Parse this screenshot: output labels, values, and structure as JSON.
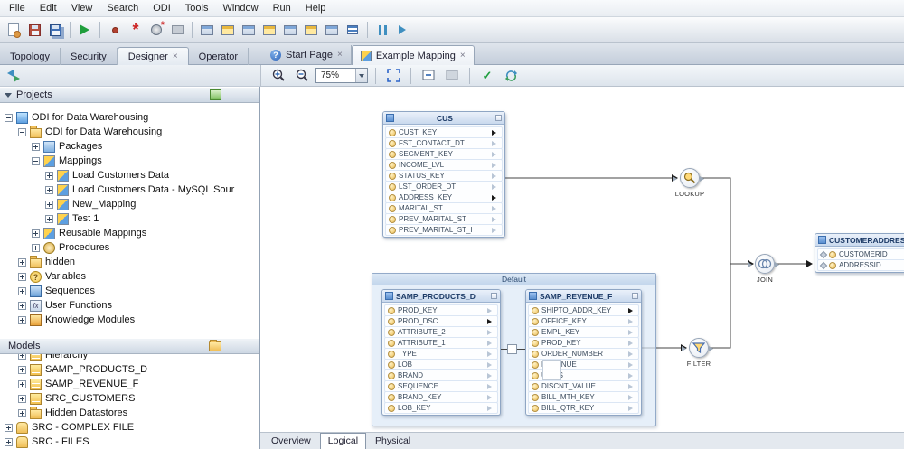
{
  "menubar": {
    "items": [
      "File",
      "Edit",
      "View",
      "Search",
      "ODI",
      "Tools",
      "Window",
      "Run",
      "Help"
    ]
  },
  "main_tabs": {
    "tabs": [
      "Topology",
      "Security",
      "Designer",
      "Operator"
    ]
  },
  "editor_tabs": {
    "tabs": [
      "Start Page",
      "Example Mapping"
    ]
  },
  "canvas_toolbar": {
    "zoom_level": "75%"
  },
  "projects_panel": {
    "title": "Projects",
    "tree": [
      {
        "label": "ODI for Data Warehousing"
      },
      {
        "label": "ODI for Data Warehousing"
      },
      {
        "label": "Packages"
      },
      {
        "label": "Mappings"
      },
      {
        "label": "Load Customers Data"
      },
      {
        "label": "Load Customers Data - MySQL Sour"
      },
      {
        "label": "New_Mapping"
      },
      {
        "label": "Test 1"
      },
      {
        "label": "Reusable Mappings"
      },
      {
        "label": "Procedures"
      },
      {
        "label": "hidden"
      },
      {
        "label": "Variables"
      },
      {
        "label": "Sequences"
      },
      {
        "label": "User Functions"
      },
      {
        "label": "Knowledge Modules"
      }
    ]
  },
  "models_panel": {
    "title": "Models",
    "tree": [
      {
        "label": "Hierarchy"
      },
      {
        "label": "SAMP_PRODUCTS_D"
      },
      {
        "label": "SAMP_REVENUE_F"
      },
      {
        "label": "SRC_CUSTOMERS"
      },
      {
        "label": "Hidden Datastores"
      },
      {
        "label": "SRC - COMPLEX FILE"
      },
      {
        "label": "SRC - FILES"
      }
    ]
  },
  "mapping": {
    "group_label": "Default",
    "cus": {
      "title": "CUS",
      "columns": [
        "CUST_KEY",
        "FST_CONTACT_DT",
        "SEGMENT_KEY",
        "INCOME_LVL",
        "STATUS_KEY",
        "LST_ORDER_DT",
        "ADDRESS_KEY",
        "MARITAL_ST",
        "PREV_MARITAL_ST",
        "PREV_MARITAL_ST_I"
      ]
    },
    "products": {
      "title": "SAMP_PRODUCTS_D",
      "columns": [
        "PROD_KEY",
        "PROD_DSC",
        "ATTRIBUTE_2",
        "ATTRIBUTE_1",
        "TYPE",
        "LOB",
        "BRAND",
        "SEQUENCE",
        "BRAND_KEY",
        "LOB_KEY"
      ]
    },
    "revenue": {
      "title": "SAMP_REVENUE_F",
      "columns": [
        "SHIPTO_ADDR_KEY",
        "OFFICE_KEY",
        "EMPL_KEY",
        "PROD_KEY",
        "ORDER_NUMBER",
        "REVENUE",
        "UNITS",
        "DISCNT_VALUE",
        "BILL_MTH_KEY",
        "BILL_QTR_KEY"
      ]
    },
    "customeraddress": {
      "title": "CUSTOMERADDRESSR",
      "columns": [
        "CUSTOMERID",
        "ADDRESSID"
      ]
    },
    "operators": {
      "lookup": "LOOKUP",
      "join": "JOIN",
      "filter": "FILTER"
    }
  },
  "bottom_tabs": {
    "tabs": [
      "Overview",
      "Logical",
      "Physical"
    ]
  }
}
